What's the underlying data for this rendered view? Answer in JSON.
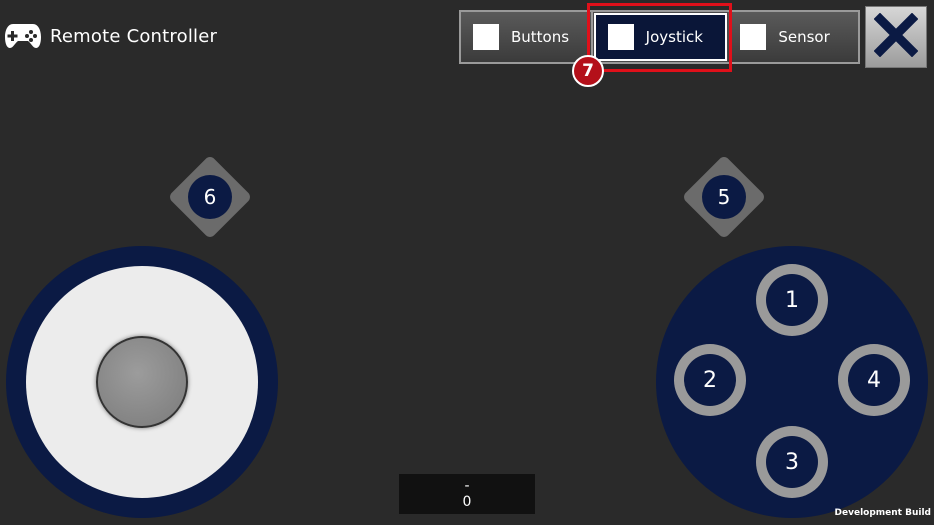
{
  "header": {
    "title": "Remote Controller",
    "icon": "gamepad-icon"
  },
  "mode_tabs": [
    {
      "label": "Buttons",
      "active": false
    },
    {
      "label": "Joystick",
      "active": true
    },
    {
      "label": "Sensor",
      "active": false
    }
  ],
  "annotation": {
    "step_number": "7",
    "color": "#e0101a"
  },
  "close_button": {
    "icon": "close-x-icon"
  },
  "side_buttons": {
    "left": "6",
    "right": "5"
  },
  "action_buttons": {
    "top": "1",
    "left": "2",
    "bottom": "3",
    "right": "4"
  },
  "value_display": {
    "label": "-",
    "value": "0"
  },
  "footer": {
    "build_label": "Development Build"
  },
  "colors": {
    "background": "#2a2a2a",
    "navy": "#0b1a44",
    "highlight": "#e0101a"
  }
}
